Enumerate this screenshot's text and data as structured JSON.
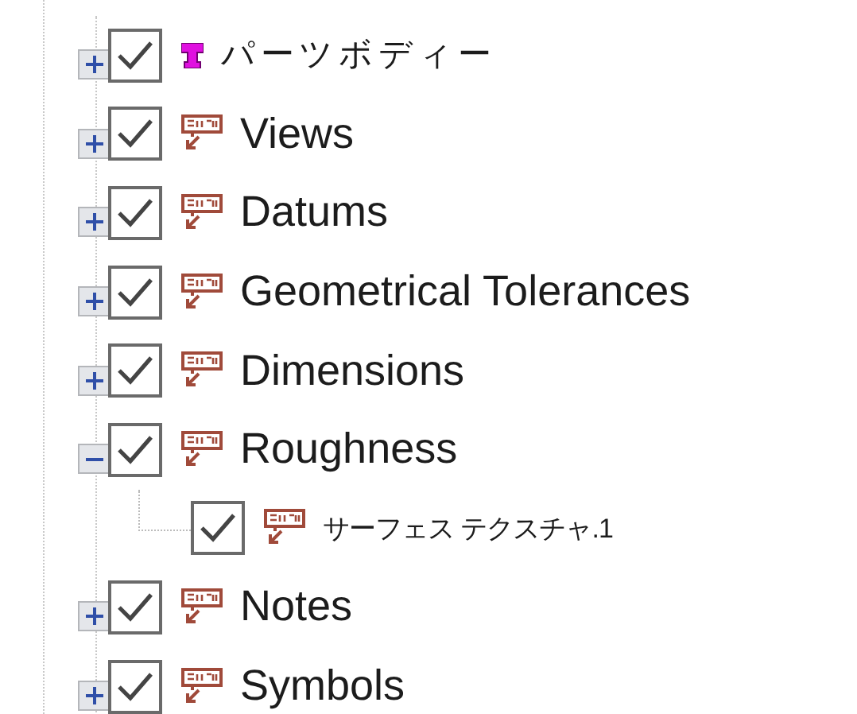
{
  "tree": {
    "items": [
      {
        "label": "パーツボディー",
        "kind": "part",
        "checked": true,
        "expanded": false
      },
      {
        "label": "Views",
        "kind": "annotation",
        "checked": true,
        "expanded": false
      },
      {
        "label": "Datums",
        "kind": "annotation",
        "checked": true,
        "expanded": false
      },
      {
        "label": "Geometrical Tolerances",
        "kind": "annotation",
        "checked": true,
        "expanded": false
      },
      {
        "label": "Dimensions",
        "kind": "annotation",
        "checked": true,
        "expanded": false
      },
      {
        "label": "Roughness",
        "kind": "annotation",
        "checked": true,
        "expanded": true,
        "children": [
          {
            "label": "サーフェス テクスチャ.1",
            "kind": "annotation",
            "checked": true
          }
        ]
      },
      {
        "label": "Notes",
        "kind": "annotation",
        "checked": true,
        "expanded": false
      },
      {
        "label": "Symbols",
        "kind": "annotation",
        "checked": true,
        "expanded": false
      }
    ]
  }
}
